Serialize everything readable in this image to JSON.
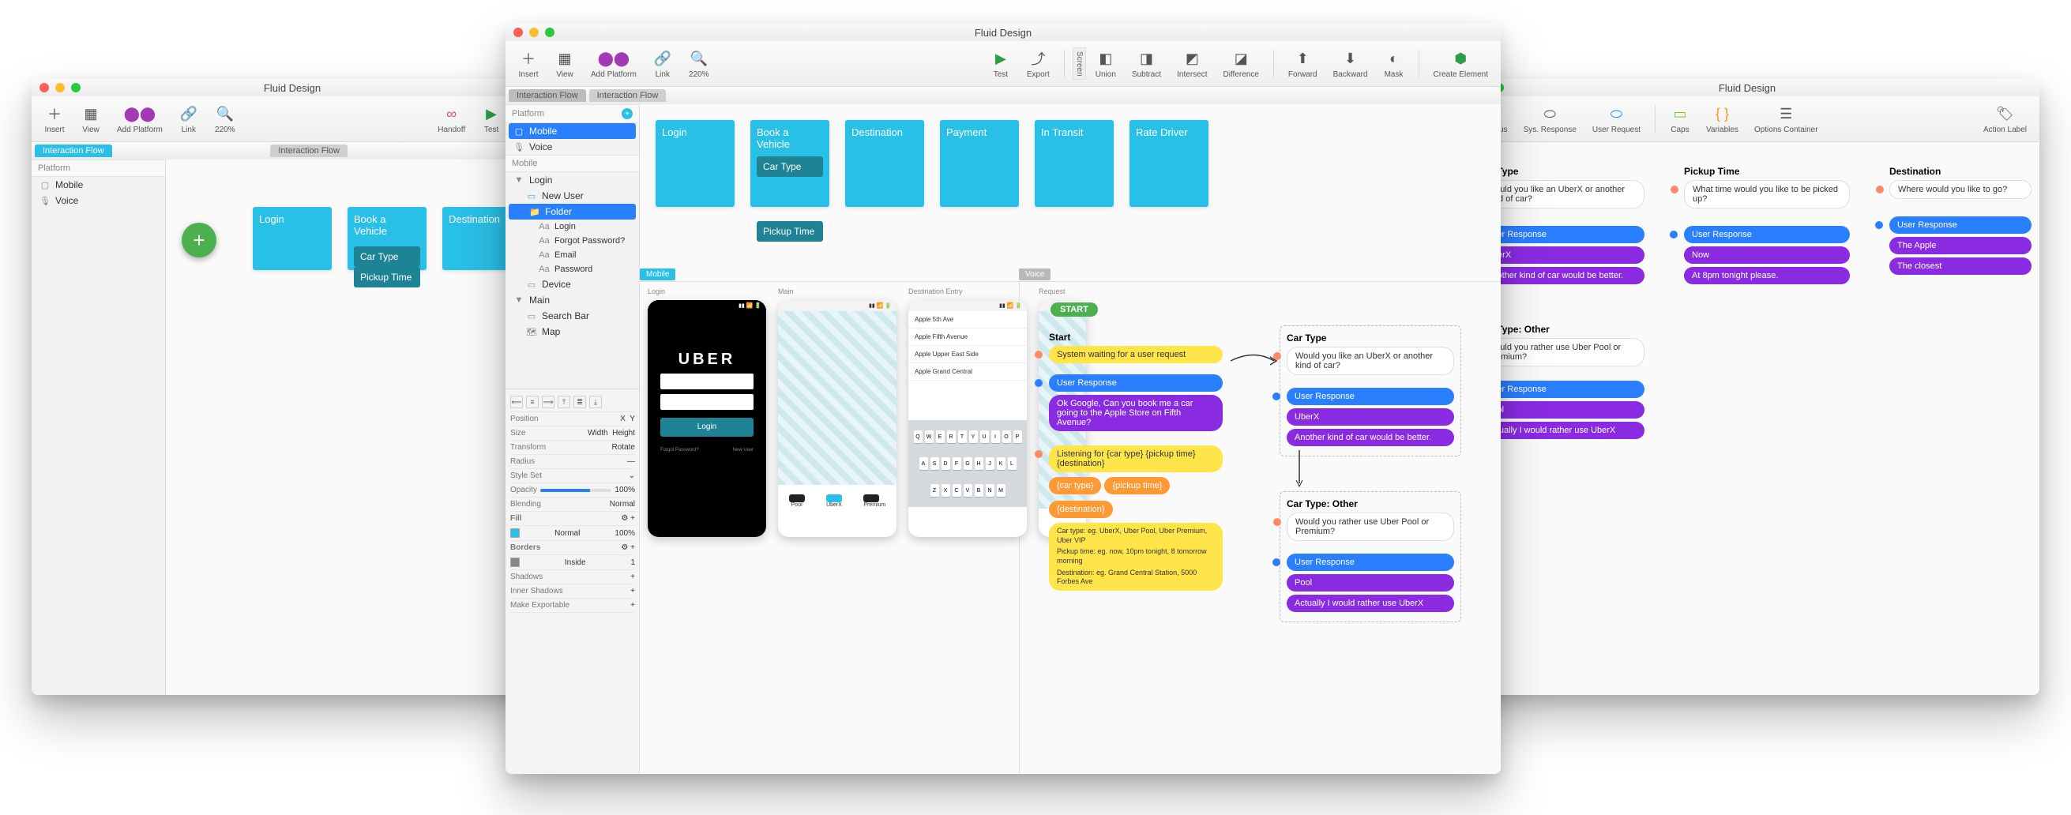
{
  "app_title": "Fluid Design",
  "toolbar": {
    "insert": "Insert",
    "view": "View",
    "add_platform": "Add Platform",
    "link": "Link",
    "zoom": "220%",
    "handoff": "Handoff",
    "test": "Test",
    "export": "Export",
    "union": "Union",
    "subtract": "Subtract",
    "intersect": "Intersect",
    "difference": "Difference",
    "forward": "Forward",
    "backward": "Backward",
    "mask": "Mask",
    "create_element": "Create Element",
    "sys_status": "Sys. Status",
    "sys_response": "Sys. Response",
    "user_request": "User Request",
    "caps": "Caps",
    "variables": "Variables",
    "options_container": "Options Container",
    "action_label": "Action Label"
  },
  "tabs": {
    "interaction_flow": "Interaction Flow"
  },
  "sidebar": {
    "platform_header": "Platform",
    "mobile": "Mobile",
    "voice": "Voice",
    "mobile_header": "Mobile",
    "login_group": "Login",
    "items": {
      "new_user": "New User",
      "folder": "Folder",
      "login": "Login",
      "forgot_password": "Forgot Password?",
      "email": "Email",
      "password": "Password",
      "device": "Device"
    },
    "main_group": "Main",
    "search_bar": "Search Bar",
    "map": "Map"
  },
  "cards": {
    "login": "Login",
    "book": "Book a Vehicle",
    "destination": "Destination",
    "payment": "Payment",
    "in_transit": "In Transit",
    "rate_driver": "Rate Driver",
    "car_type": "Car Type",
    "pickup_time": "Pickup Time"
  },
  "inspector": {
    "position": "Position",
    "size": "Size",
    "width_ph": "Width",
    "height_ph": "Height",
    "transform": "Transform",
    "rotate": "Rotate",
    "radius": "Radius",
    "style_set": "Style Set",
    "opacity": "Opacity",
    "opacity_val": "100%",
    "blending": "Blending",
    "blending_val": "Normal",
    "fill": "Fill",
    "fill_val": "Normal",
    "fill_pct": "100%",
    "borders": "Borders",
    "borders_val": "Inside",
    "borders_px": "1",
    "shadows": "Shadows",
    "inner_shadows": "Inner Shadows",
    "make_exportable": "Make Exportable"
  },
  "mock": {
    "login_title": "Login",
    "uber": "UBER",
    "login_btn": "Login",
    "forgot": "Forgot Password?",
    "new_user": "New User",
    "main_title": "Main",
    "dest_title": "Destination Entry",
    "req_title": "Request",
    "pool": "Pool",
    "uberx": "UberX",
    "premium": "Premium",
    "search_rows": [
      "Apple 5th Ave",
      "Apple Fifth Avenue",
      "Apple Upper East Side",
      "Apple Grand Central"
    ],
    "keyboard_rows": [
      [
        "Q",
        "W",
        "E",
        "R",
        "T",
        "Y",
        "U",
        "I",
        "O",
        "P"
      ],
      [
        "A",
        "S",
        "D",
        "F",
        "G",
        "H",
        "J",
        "K",
        "L"
      ],
      [
        "Z",
        "X",
        "C",
        "V",
        "B",
        "N",
        "M"
      ]
    ]
  },
  "voice": {
    "mobile_label": "Mobile",
    "voice_label": "Voice",
    "screen_label": "Screen",
    "start_pill": "START",
    "start_title": "Start",
    "sys_wait": "System waiting for a user request",
    "user_response": "User Response",
    "ok_google": "Ok Google, Can you book me a car going to the Apple Store on Fifth Avenue?",
    "listening": "Listening for {car type} {pickup time} {destination}",
    "var_car_type": "{car type}",
    "var_pickup_time": "{pickup time}",
    "var_destination": "{destination}",
    "examples_car": "Car type: eg. UberX, Uber Pool, Uber Premium, Uber VIP",
    "examples_pickup": "Pickup time: eg. now, 10pm tonight, 8 tomorrow morning",
    "examples_dest": "Destination: eg. Grand Central Station, 5000 Forbes Ave",
    "car_type_title": "Car Type",
    "car_type_q": "Would you like an UberX or another kind of car?",
    "uberx": "UberX",
    "another_car": "Another kind of car would be better.",
    "car_type_other_title": "Car Type: Other",
    "car_type_other_q": "Would you rather use Uber Pool or Premium?",
    "pool": "Pool",
    "rather_uberx": "Actually I would rather use UberX",
    "pickup_title": "Pickup Time",
    "pickup_q": "What time would you like to be picked up?",
    "now": "Now",
    "at8pm": "At 8pm tonight please.",
    "dest_title": "Destination",
    "dest_q": "Where would you like to go?",
    "the_apple": "The Apple",
    "the_close": "The closest"
  }
}
